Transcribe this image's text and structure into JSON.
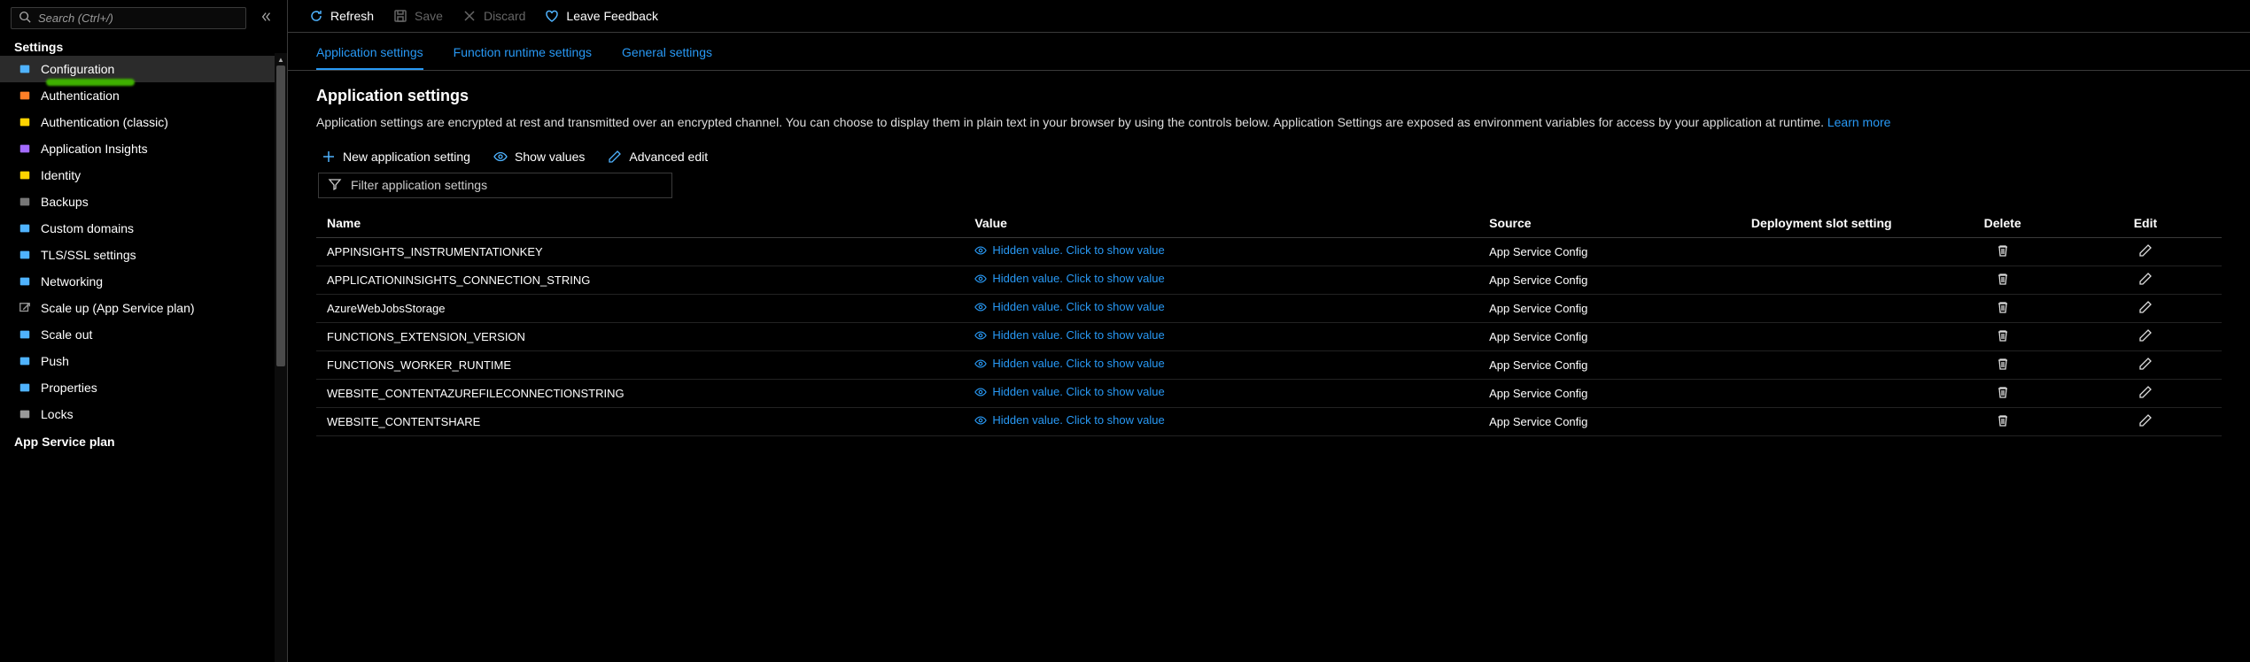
{
  "search": {
    "placeholder": "Search (Ctrl+/)"
  },
  "sidebar": {
    "section_label": "Settings",
    "items": [
      {
        "label": "Configuration",
        "icon": "sliders-icon",
        "color": "#4fb3ff",
        "selected": true,
        "highlight": true
      },
      {
        "label": "Authentication",
        "icon": "auth-icon",
        "color": "#ff7f27"
      },
      {
        "label": "Authentication (classic)",
        "icon": "key-icon",
        "color": "#ffd400"
      },
      {
        "label": "Application Insights",
        "icon": "bulb-icon",
        "color": "#a36bff"
      },
      {
        "label": "Identity",
        "icon": "identity-icon",
        "color": "#ffd400"
      },
      {
        "label": "Backups",
        "icon": "backup-icon",
        "color": "#777"
      },
      {
        "label": "Custom domains",
        "icon": "domain-icon",
        "color": "#4fb3ff"
      },
      {
        "label": "TLS/SSL settings",
        "icon": "shield-icon",
        "color": "#4fb3ff"
      },
      {
        "label": "Networking",
        "icon": "network-icon",
        "color": "#4fb3ff"
      },
      {
        "label": "Scale up (App Service plan)",
        "icon": "scaleup-icon",
        "color": "#999",
        "external": true
      },
      {
        "label": "Scale out",
        "icon": "scaleout-icon",
        "color": "#4fb3ff"
      },
      {
        "label": "Push",
        "icon": "push-icon",
        "color": "#4fb3ff"
      },
      {
        "label": "Properties",
        "icon": "properties-icon",
        "color": "#4fb3ff"
      },
      {
        "label": "Locks",
        "icon": "lock-icon",
        "color": "#999"
      }
    ],
    "footer_label": "App Service plan"
  },
  "toolbar": {
    "refresh": "Refresh",
    "save": "Save",
    "discard": "Discard",
    "feedback": "Leave Feedback"
  },
  "tabs": [
    {
      "label": "Application settings",
      "active": true
    },
    {
      "label": "Function runtime settings"
    },
    {
      "label": "General settings"
    }
  ],
  "heading": "Application settings",
  "description": "Application settings are encrypted at rest and transmitted over an encrypted channel. You can choose to display them in plain text in your browser by using the controls below. Application Settings are exposed as environment variables for access by your application at runtime. ",
  "learn_more": "Learn more",
  "actions": {
    "new": "New application setting",
    "show": "Show values",
    "advanced": "Advanced edit"
  },
  "filter_placeholder": "Filter application settings",
  "table": {
    "columns": [
      "Name",
      "Value",
      "Source",
      "Deployment slot setting",
      "Delete",
      "Edit"
    ],
    "hidden_value_text": "Hidden value. Click to show value",
    "rows": [
      {
        "name": "APPINSIGHTS_INSTRUMENTATIONKEY",
        "source": "App Service Config"
      },
      {
        "name": "APPLICATIONINSIGHTS_CONNECTION_STRING",
        "source": "App Service Config"
      },
      {
        "name": "AzureWebJobsStorage",
        "source": "App Service Config"
      },
      {
        "name": "FUNCTIONS_EXTENSION_VERSION",
        "source": "App Service Config"
      },
      {
        "name": "FUNCTIONS_WORKER_RUNTIME",
        "source": "App Service Config"
      },
      {
        "name": "WEBSITE_CONTENTAZUREFILECONNECTIONSTRING",
        "source": "App Service Config"
      },
      {
        "name": "WEBSITE_CONTENTSHARE",
        "source": "App Service Config"
      }
    ]
  }
}
